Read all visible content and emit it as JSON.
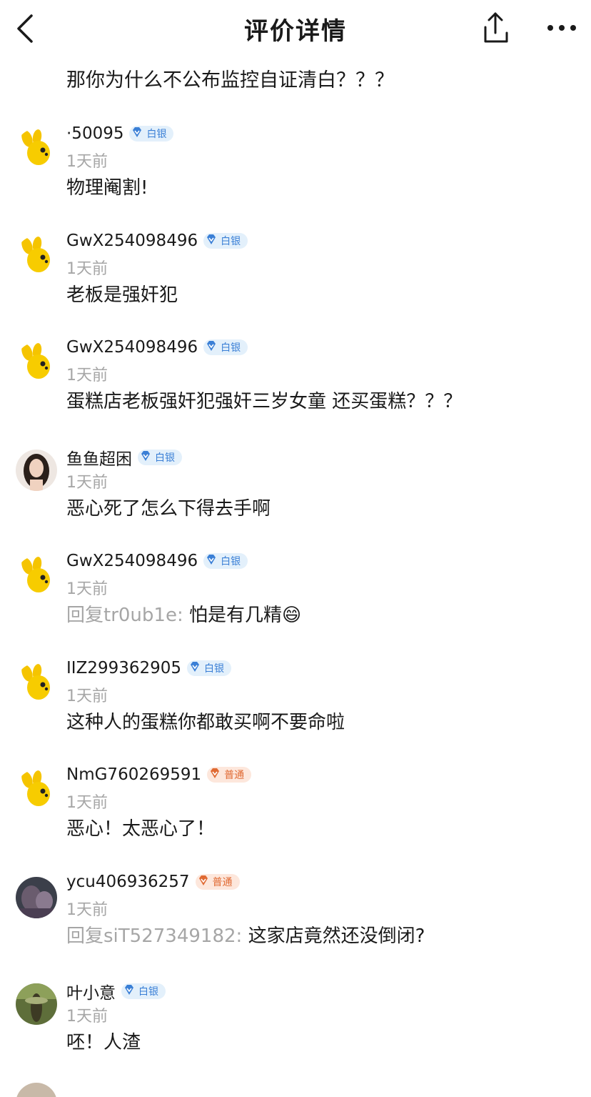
{
  "header": {
    "title": "评价详情",
    "back_icon": "chevron-left-icon",
    "share_icon": "share-icon",
    "more_icon": "more-dots-icon"
  },
  "first_comment_text": "那你为什么不公布监控自证清白？？？",
  "comments": [
    {
      "user": "·50095",
      "badge": "白银",
      "badge_type": "silver",
      "avatar": "yellow-mascot",
      "time": "1天前",
      "reply_prefix": "",
      "text": "物理阉割!"
    },
    {
      "user": "GwX254098496",
      "badge": "白银",
      "badge_type": "silver",
      "avatar": "yellow-mascot",
      "time": "1天前",
      "reply_prefix": "",
      "text": "老板是强奸犯"
    },
    {
      "user": "GwX254098496",
      "badge": "白银",
      "badge_type": "silver",
      "avatar": "yellow-mascot",
      "time": "1天前",
      "reply_prefix": "",
      "text": "蛋糕店老板强奸犯强奸三岁女童 还买蛋糕？？？"
    },
    {
      "user": "鱼鱼超困",
      "badge": "白银",
      "badge_type": "silver",
      "avatar": "photo-woman",
      "time": "1天前",
      "reply_prefix": "",
      "text": "恶心死了怎么下得去手啊"
    },
    {
      "user": "GwX254098496",
      "badge": "白银",
      "badge_type": "silver",
      "avatar": "yellow-mascot",
      "time": "1天前",
      "reply_prefix": "回复tr0ub1e: ",
      "text": "怕是有几精😄"
    },
    {
      "user": "IIZ299362905",
      "badge": "白银",
      "badge_type": "silver",
      "avatar": "yellow-mascot",
      "time": "1天前",
      "reply_prefix": "",
      "text": "这种人的蛋糕你都敢买啊不要命啦"
    },
    {
      "user": "NmG760269591",
      "badge": "普通",
      "badge_type": "normal",
      "avatar": "yellow-mascot",
      "time": "1天前",
      "reply_prefix": "",
      "text": "恶心！太恶心了！"
    },
    {
      "user": "ycu406936257",
      "badge": "普通",
      "badge_type": "normal",
      "avatar": "photo-dark",
      "time": "1天前",
      "reply_prefix": "回复siT527349182: ",
      "text": "这家店竟然还没倒闭?"
    },
    {
      "user": "叶小意",
      "badge": "白银",
      "badge_type": "silver",
      "avatar": "photo-green",
      "time": "1天前",
      "reply_prefix": "",
      "text": "呸！人渣"
    }
  ],
  "colors": {
    "silver_badge": "#3a7fd6",
    "normal_badge": "#e06a33",
    "muted": "#a6a6a6"
  }
}
